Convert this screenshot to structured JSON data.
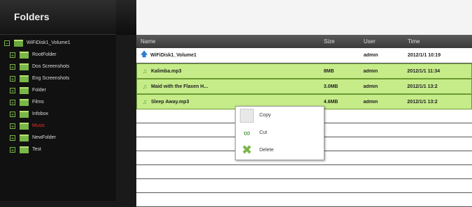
{
  "sidebar": {
    "title": "Folders",
    "root": {
      "label": "WiFiDisk1_Volume1"
    },
    "items": [
      {
        "label": "RootFolder"
      },
      {
        "label": "Dos Screenshots"
      },
      {
        "label": "Eng Screenshots"
      },
      {
        "label": "Folder"
      },
      {
        "label": "Films"
      },
      {
        "label": "Infobox"
      },
      {
        "label": "Music",
        "selected": true
      },
      {
        "label": "NewFolder"
      },
      {
        "label": "Test"
      }
    ]
  },
  "toolbar": {
    "icons": [
      "settings-icon",
      "upload-icon",
      "new-folder-icon",
      "copy-icon",
      "paste-icon",
      "download-icon",
      "delete-icon",
      "rename-icon",
      "refresh-icon"
    ]
  },
  "table": {
    "headers": [
      "Name",
      "Size",
      "User",
      "Time"
    ],
    "rows": [
      {
        "name": "WiFiDisk1_Volume1",
        "size": "",
        "user": "admin",
        "time": "2012/1/1 10:19",
        "kind": "up"
      },
      {
        "name": "Kalimba.mp3",
        "size": "8MB",
        "user": "admin",
        "time": "2012/1/1 11:34",
        "kind": "file"
      },
      {
        "name": "Maid with the Flaxen H...",
        "size": "3.0MB",
        "user": "admin",
        "time": "2012/1/1 13:2",
        "kind": "file"
      },
      {
        "name": "Sleep Away.mp3",
        "size": "4.6MB",
        "user": "admin",
        "time": "2012/1/1 13:2",
        "kind": "file"
      }
    ]
  },
  "context_menu": {
    "items": [
      {
        "label": "Copy",
        "icon": "copy-icon"
      },
      {
        "label": "Cut",
        "icon": "scissors-icon"
      },
      {
        "label": "Delete",
        "icon": "delete-icon"
      }
    ]
  },
  "colors": {
    "accent_green": "#7ab648",
    "selected_row": "#c6ec8a",
    "selected_folder_text": "#e03030"
  }
}
